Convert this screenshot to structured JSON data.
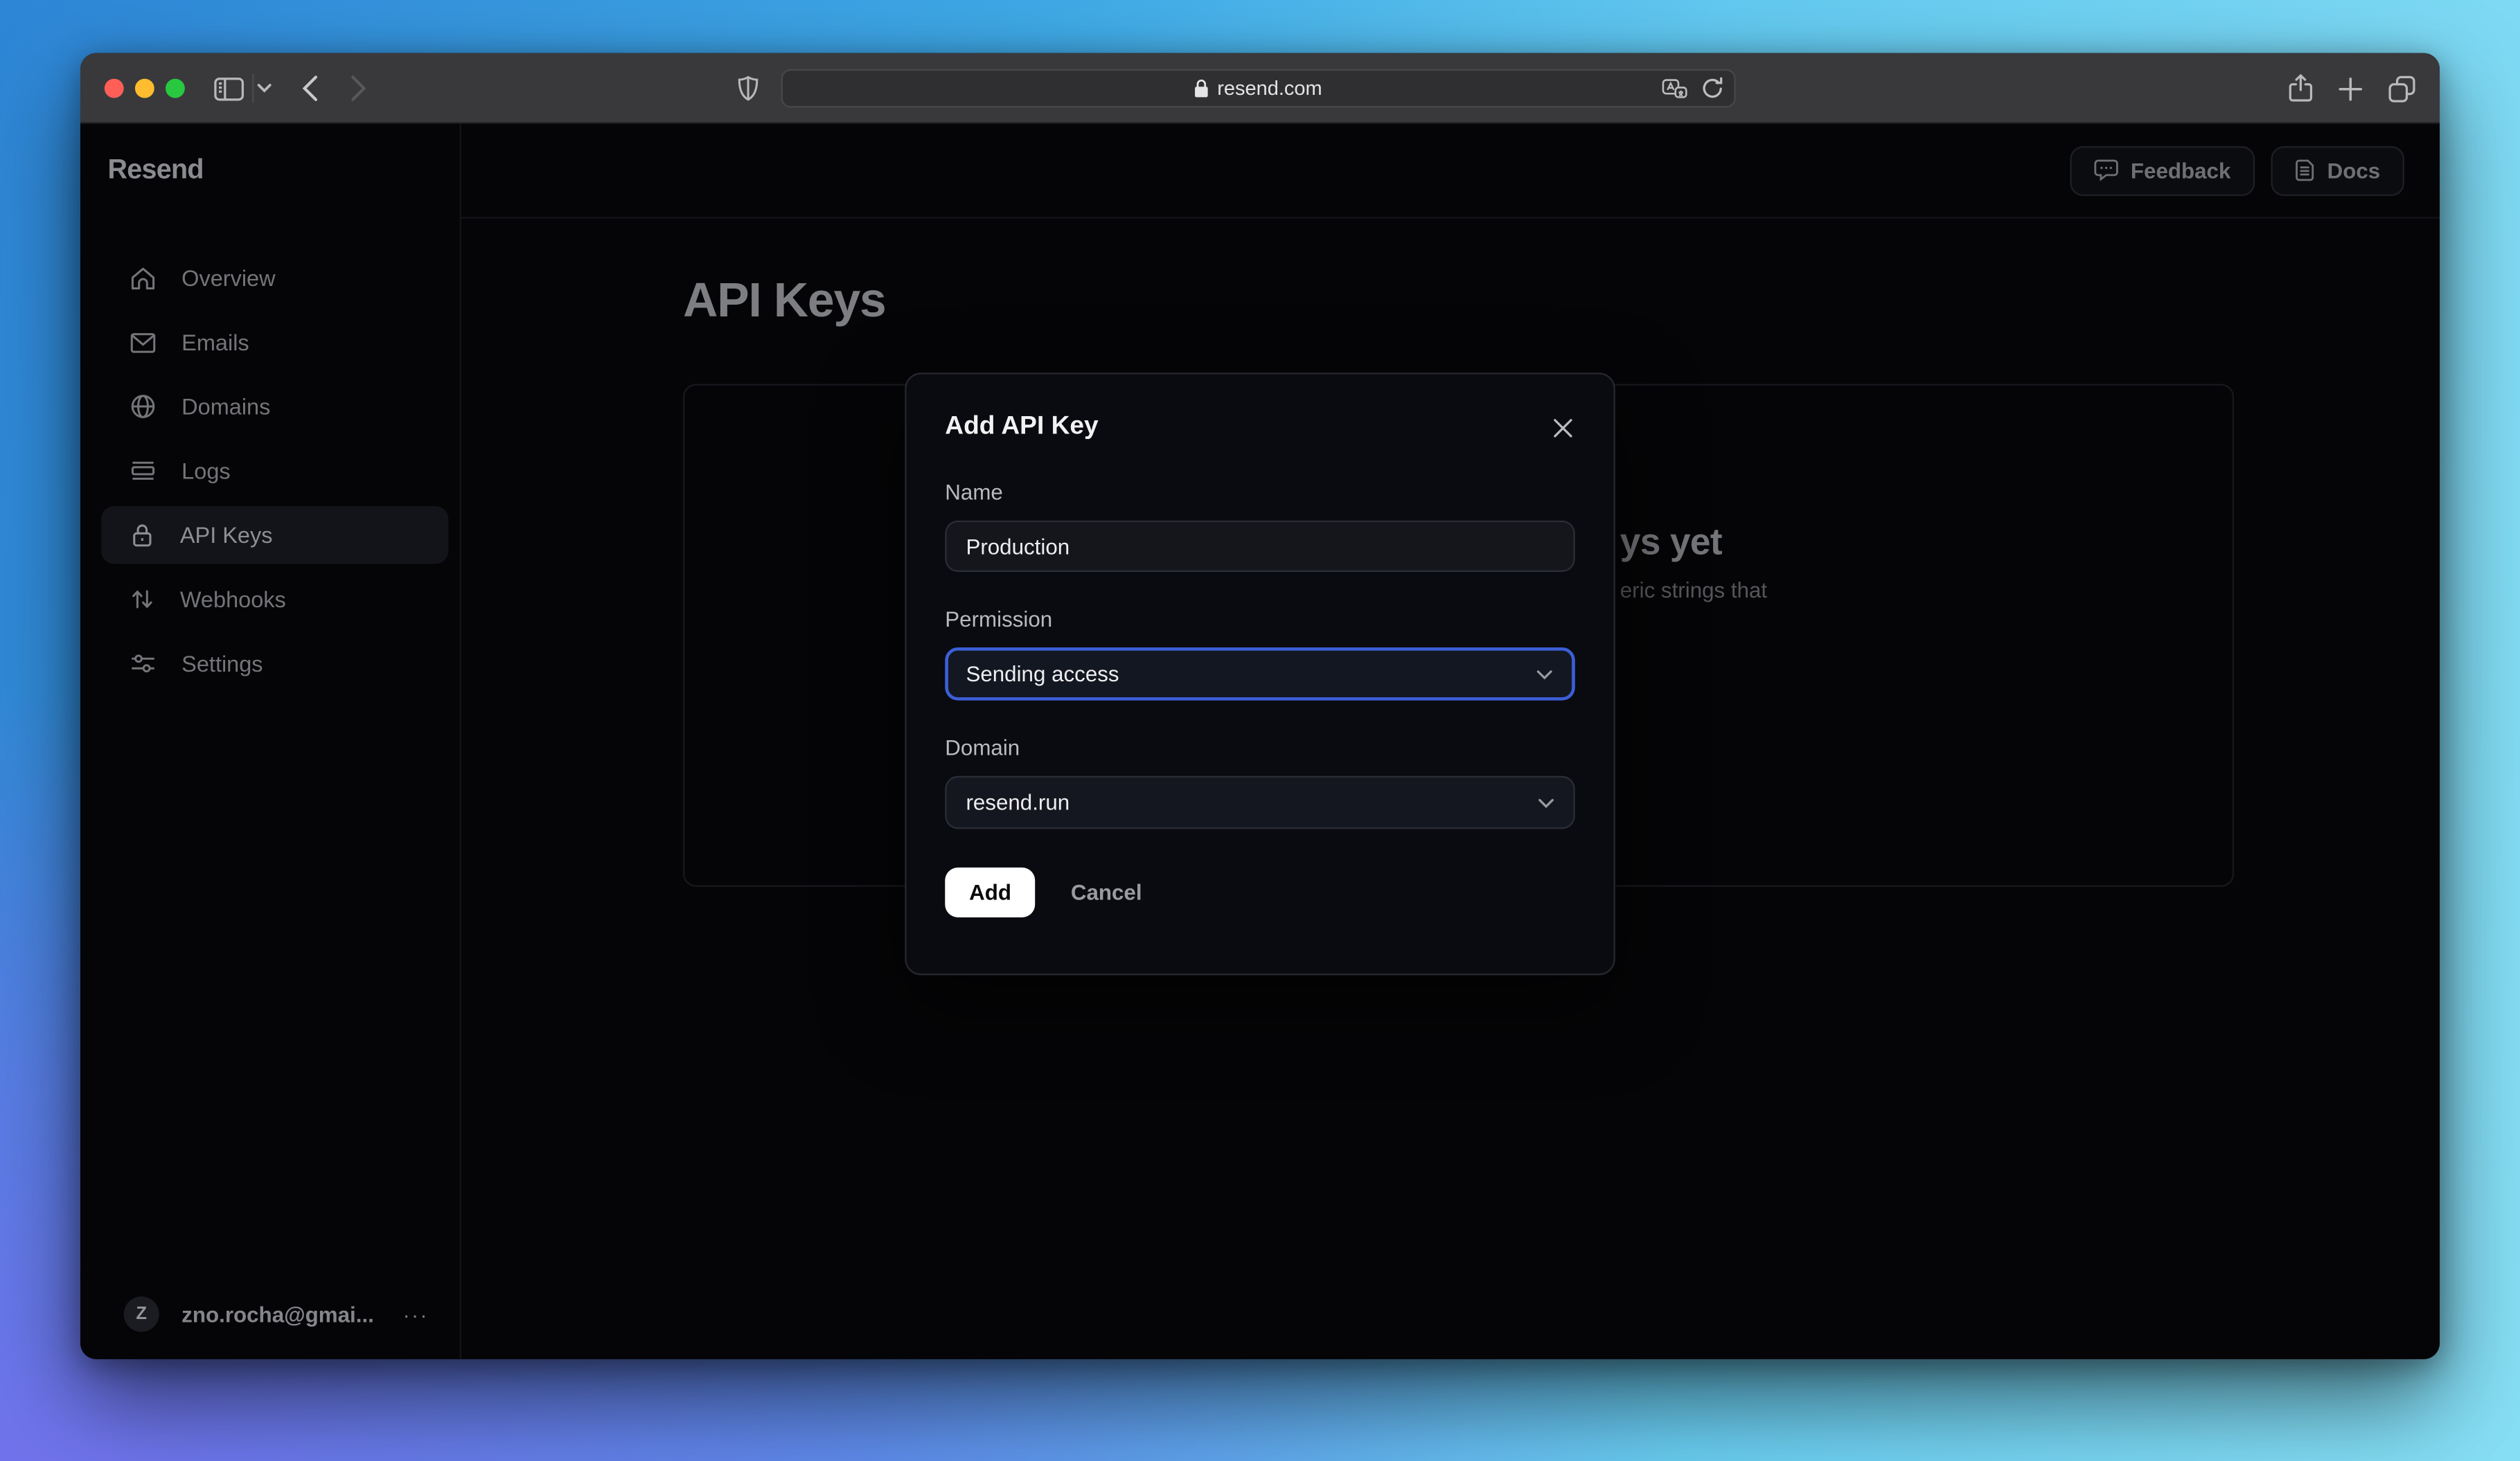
{
  "browser": {
    "url": "resend.com",
    "toolbar_icon_names": [
      "sidebar-toggle-icon",
      "tab-chevron-icon",
      "back-icon",
      "forward-icon",
      "privacy-shield-icon",
      "lock-icon",
      "translate-icon",
      "reload-icon",
      "share-icon",
      "new-tab-icon",
      "tab-overview-icon"
    ]
  },
  "app": {
    "logo": "Resend",
    "header": {
      "feedback_label": "Feedback",
      "docs_label": "Docs"
    },
    "sidebar": {
      "items": [
        {
          "label": "Overview",
          "icon": "home-icon",
          "active": false
        },
        {
          "label": "Emails",
          "icon": "envelope-icon",
          "active": false
        },
        {
          "label": "Domains",
          "icon": "globe-icon",
          "active": false
        },
        {
          "label": "Logs",
          "icon": "logs-icon",
          "active": false
        },
        {
          "label": "API Keys",
          "icon": "lock-icon",
          "active": true
        },
        {
          "label": "Webhooks",
          "icon": "webhooks-icon",
          "active": false
        },
        {
          "label": "Settings",
          "icon": "sliders-icon",
          "active": false
        }
      ]
    },
    "page": {
      "title": "API Keys",
      "empty_state_heading_fragment": "ys yet",
      "empty_state_body_fragment": "eric strings that"
    },
    "account": {
      "avatar_initial": "Z",
      "email": "zno.rocha@gmai...",
      "more": "···"
    }
  },
  "modal": {
    "title": "Add API Key",
    "fields": {
      "name": {
        "label": "Name",
        "value": "Production"
      },
      "permission": {
        "label": "Permission",
        "value": "Sending access"
      },
      "domain": {
        "label": "Domain",
        "value": "resend.run"
      }
    },
    "buttons": {
      "add": "Add",
      "cancel": "Cancel"
    }
  },
  "colors": {
    "accent_focus": "#3c5fd7",
    "traffic_red": "#ff5f57",
    "traffic_yellow": "#febc2e",
    "traffic_green": "#28c840",
    "wallpaper_top_left": "#2e86d6",
    "wallpaper_top_right": "#87dff5",
    "wallpaper_bottom_left": "#7671ee",
    "wallpaper_bottom_right": "#41c4f2"
  }
}
